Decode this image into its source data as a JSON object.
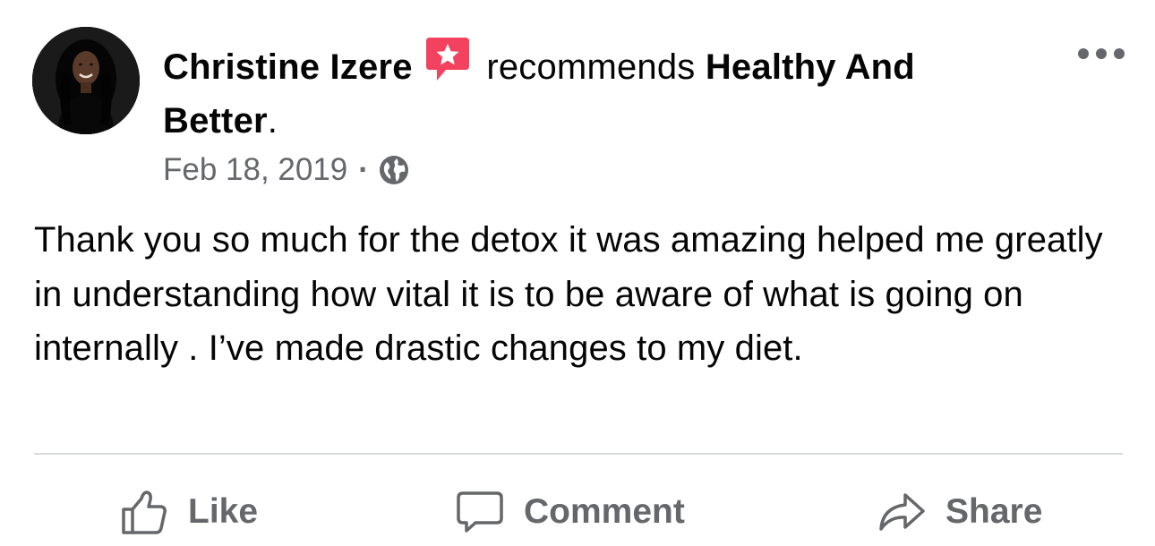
{
  "post": {
    "author": "Christine Izere",
    "recommendation_icon": "recommend-star-badge-icon",
    "verb": "recommends",
    "page_name": "Healthy And Better",
    "punctuation": ".",
    "date": "Feb 18, 2019",
    "separator": "·",
    "audience_icon": "globe-icon",
    "text": "Thank you so much for the detox it was amazing helped me greatly in understanding how vital it is to be aware of what is going on internally . I’ve made drastic changes to my diet."
  },
  "actions": {
    "like_label": "Like",
    "comment_label": "Comment",
    "share_label": "Share"
  },
  "colors": {
    "text_primary": "#050505",
    "text_secondary": "#65676b",
    "recommend_badge": "#f3425f",
    "divider": "#d9dadc"
  }
}
